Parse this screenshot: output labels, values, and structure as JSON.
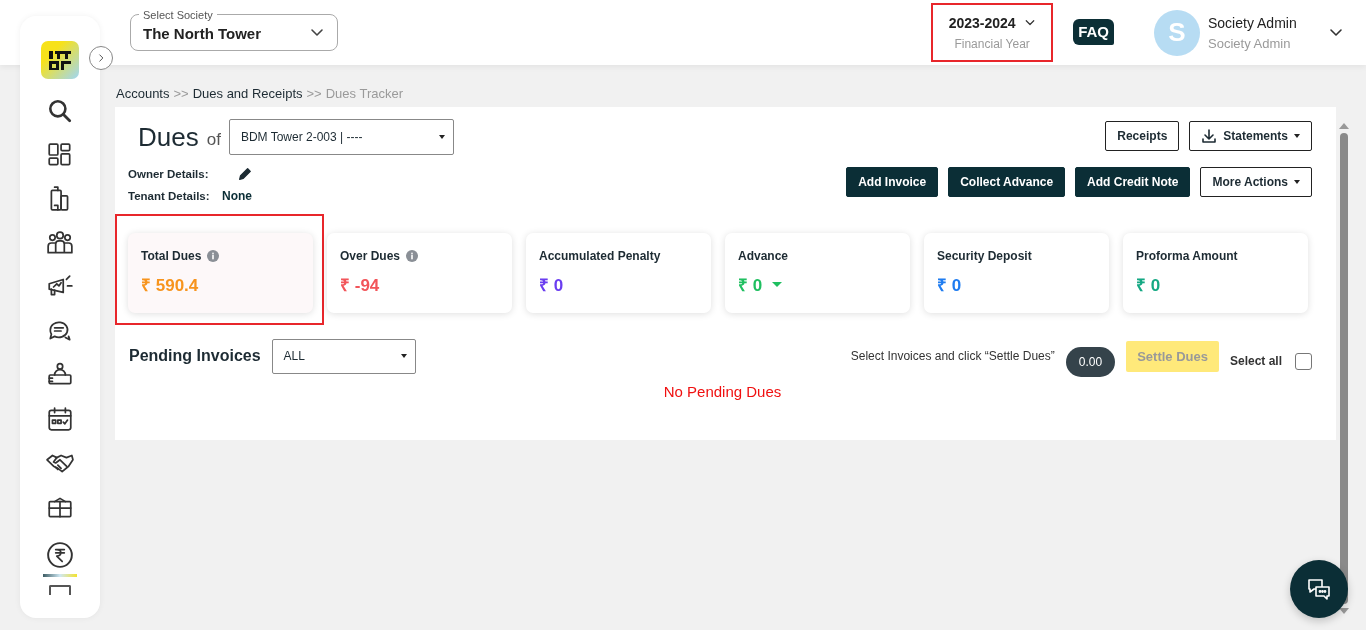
{
  "sidebar": {
    "items": [
      {
        "selected": false
      },
      {
        "selected": false
      },
      {
        "selected": false
      },
      {
        "selected": false
      },
      {
        "selected": false
      },
      {
        "selected": false
      },
      {
        "selected": false
      },
      {
        "selected": false
      },
      {
        "selected": false
      },
      {
        "selected": false
      },
      {
        "selected": true
      }
    ]
  },
  "header": {
    "society_select": {
      "label": "Select Society",
      "value": "The North Tower"
    },
    "financial_year": {
      "value": "2023-2024",
      "label": "Financial Year",
      "highlighted": true
    },
    "faq": "FAQ",
    "user": {
      "initial": "S",
      "name": "Society Admin",
      "role": "Society Admin"
    }
  },
  "breadcrumb": [
    {
      "label": "Accounts",
      "current": false
    },
    {
      "label": "Dues and Receipts",
      "current": false
    },
    {
      "label": "Dues Tracker",
      "current": true
    }
  ],
  "breadcrumb_separators": [
    ">>",
    ">>"
  ],
  "dues": {
    "title": "Dues",
    "of": "of",
    "unit_select": "BDM Tower 2-003 | ----",
    "owner_label": "Owner Details:",
    "tenant_label": "Tenant Details:",
    "tenant_value": "None",
    "top_buttons": [
      {
        "label": "Receipts",
        "kind": "plain"
      },
      {
        "label": "Statements",
        "kind": "download"
      }
    ],
    "action_buttons": [
      {
        "label": "Add Invoice",
        "kind": "dark"
      },
      {
        "label": "Collect Advance",
        "kind": "dark"
      },
      {
        "label": "Add Credit Note",
        "kind": "dark"
      },
      {
        "label": "More Actions",
        "kind": "menu"
      }
    ]
  },
  "cards": [
    {
      "title": "Total Dues",
      "value": "₹ 590.4",
      "color": "#f7941d",
      "info": true,
      "caret": false,
      "highlighted": true
    },
    {
      "title": "Over Dues",
      "value": "₹ -94",
      "color": "#f2555a",
      "info": true,
      "caret": false,
      "highlighted": false
    },
    {
      "title": "Accumulated Penalty",
      "value": "₹ 0",
      "color": "#6a3df0",
      "info": false,
      "caret": false,
      "highlighted": false
    },
    {
      "title": "Advance",
      "value": "₹ 0",
      "color": "#1fbf60",
      "info": false,
      "caret": true,
      "highlighted": false
    },
    {
      "title": "Security Deposit",
      "value": "₹ 0",
      "color": "#1f7cf0",
      "info": false,
      "caret": false,
      "highlighted": false
    },
    {
      "title": "Proforma Amount",
      "value": "₹ 0",
      "color": "#14a883",
      "info": false,
      "caret": false,
      "highlighted": false
    }
  ],
  "pending": {
    "title": "Pending Invoices",
    "filter": "ALL",
    "hint": "Select Invoices and click “Settle Dues”",
    "total": "0.00",
    "settle_button": {
      "label": "Settle Dues",
      "disabled": true
    },
    "select_all": {
      "label": "Select all",
      "checked": false
    },
    "empty_message": "No Pending Dues"
  }
}
